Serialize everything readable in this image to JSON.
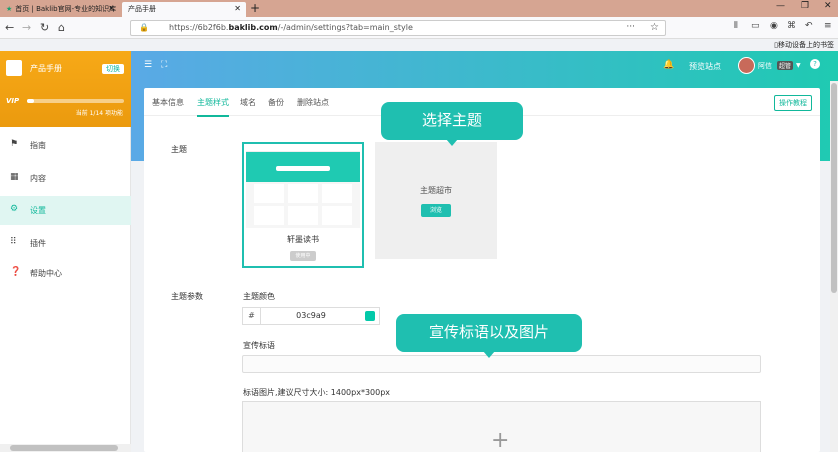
{
  "browser": {
    "tabs": [
      {
        "label": "首页 | Baklib官网-专业的知识库",
        "close": "✕"
      },
      {
        "label": "产品手册",
        "close": "✕"
      }
    ],
    "new_tab": "+",
    "url_prefix": "https://6b2f6b.",
    "url_domain": "baklib.com",
    "url_path": "/-/admin/settings?tab=main_style",
    "mobile_bookmarks": "移动设备上的书签",
    "icons": [
      "back-icon",
      "forward-icon",
      "reload-icon",
      "home-icon",
      "lock-icon",
      "more-icon",
      "star-icon",
      "library-icon",
      "reader-icon",
      "extension-icon",
      "menu-icon"
    ]
  },
  "sidebar": {
    "brand_name": "产品手册",
    "switch_label": "切换",
    "vip": "VIP",
    "quota": "当前 1/14 项功能",
    "quota_progress": 0.07,
    "items": [
      {
        "label": "指南",
        "icon": "signpost-icon"
      },
      {
        "label": "内容",
        "icon": "grid-icon"
      },
      {
        "label": "设置",
        "icon": "gear-icon",
        "active": true
      },
      {
        "label": "插件",
        "icon": "apps-icon"
      },
      {
        "label": "帮助中心",
        "icon": "question-icon"
      }
    ]
  },
  "header": {
    "preview_site": "预览站点",
    "user_name": "阿信",
    "role_badge": "超管",
    "help": "?"
  },
  "tabs": [
    {
      "label": "基本信息"
    },
    {
      "label": "主题样式",
      "active": true
    },
    {
      "label": "域名"
    },
    {
      "label": "备份"
    },
    {
      "label": "删除站点"
    }
  ],
  "tutorial_button": "操作教程",
  "theme": {
    "label": "主题",
    "current_name": "轩墨读书",
    "current_button": "使用中",
    "market_title": "主题超市",
    "market_button": "浏览"
  },
  "params": {
    "label": "主题参数",
    "color_label": "主题颜色",
    "hash": "#",
    "color_value": "03c9a9",
    "color_hex": "#03c9a9",
    "slogan_label": "宣传标语",
    "slogan_value": "",
    "image_label": "标语图片,建议尺寸大小: 1400px*300px",
    "upload_icon": "+"
  },
  "callouts": {
    "theme": "选择主题",
    "slogan": "宣传标语以及图片"
  }
}
